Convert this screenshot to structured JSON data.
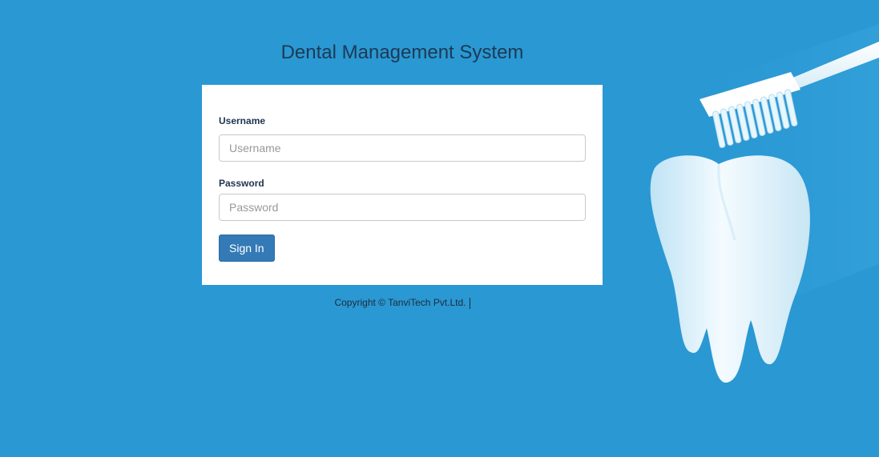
{
  "header": {
    "title": "Dental Management System"
  },
  "login_form": {
    "username_label": "Username",
    "username_placeholder": "Username",
    "username_value": "",
    "password_label": "Password",
    "password_placeholder": "Password",
    "password_value": "",
    "signin_label": "Sign In"
  },
  "footer": {
    "copyright": "Copyright © TanviTech Pvt.Ltd."
  },
  "colors": {
    "background": "#2a98d3",
    "card": "#ffffff",
    "button": "#337ab7",
    "title_text": "#1c3a55"
  },
  "icons": {
    "background_art": "tooth-and-toothbrush-illustration"
  }
}
